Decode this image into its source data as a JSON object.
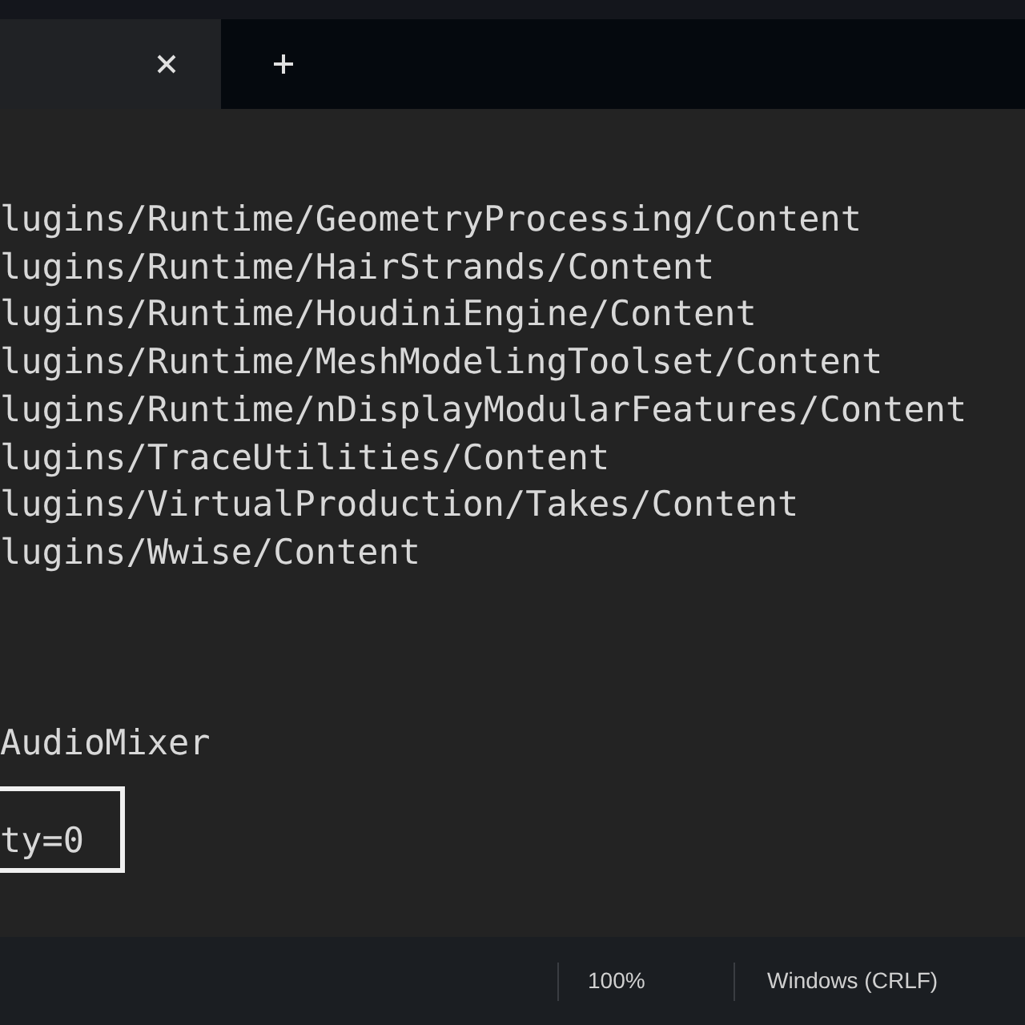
{
  "tab": {
    "selected": true
  },
  "editor": {
    "lines": [
      "lugins/Runtime/GeometryProcessing/Content",
      "lugins/Runtime/HairStrands/Content",
      "lugins/Runtime/HoudiniEngine/Content",
      "lugins/Runtime/MeshModelingToolset/Content",
      "lugins/Runtime/nDisplayModularFeatures/Content",
      "lugins/TraceUtilities/Content",
      "lugins/VirtualProduction/Takes/Content",
      "lugins/Wwise/Content"
    ],
    "later_lines": [
      "AudioMixer"
    ],
    "boxed_text": "ty=0"
  },
  "status_bar": {
    "zoom": "100%",
    "line_ending": "Windows (CRLF)"
  }
}
